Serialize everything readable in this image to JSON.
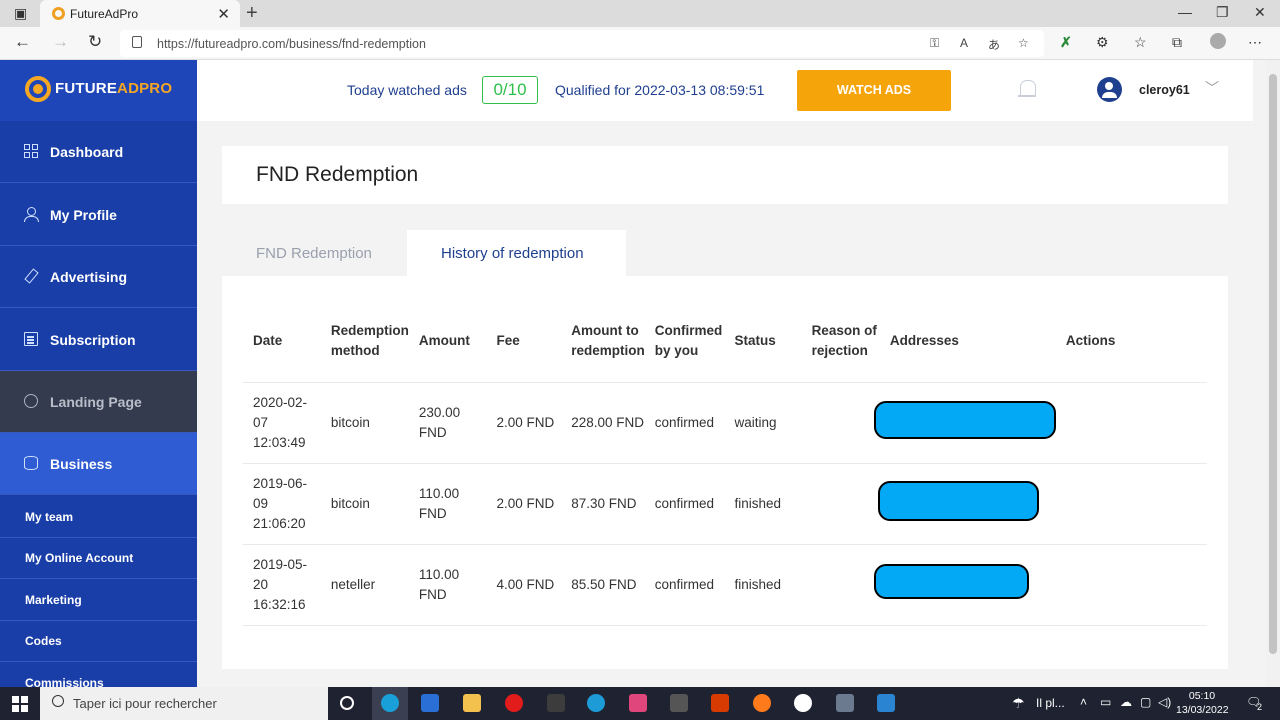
{
  "browser": {
    "tab_title": "FutureAdPro",
    "url": "https://futureadpro.com/business/fnd-redemption"
  },
  "logo": {
    "brand_main": "FUTURE",
    "brand_accent": "ADPRO"
  },
  "sidebar": {
    "items": [
      {
        "label": "Dashboard",
        "icon": "grid-icon"
      },
      {
        "label": "My Profile",
        "icon": "user-icon"
      },
      {
        "label": "Advertising",
        "icon": "megaphone-icon"
      },
      {
        "label": "Subscription",
        "icon": "document-icon"
      },
      {
        "label": "Landing Page",
        "icon": "globe-icon"
      },
      {
        "label": "Business",
        "icon": "database-icon"
      }
    ],
    "subitems": [
      "My team",
      "My Online Account",
      "Marketing",
      "Codes",
      "Commissions"
    ]
  },
  "header": {
    "watched_label": "Today watched ads",
    "watched_count": "0/10",
    "qualified_text": "Qualified for 2022-03-13 08:59:51",
    "watch_button": "WATCH ADS",
    "username": "cleroy61"
  },
  "page": {
    "title": "FND Redemption",
    "tabs": [
      "FND Redemption",
      "History of redemption"
    ],
    "active_tab": "History of redemption"
  },
  "table": {
    "headers": [
      "Date",
      "Redemption method",
      "Amount",
      "Fee",
      "Amount to redemption",
      "Confirmed by you",
      "Status",
      "Reason of rejection",
      "Addresses",
      "Actions"
    ],
    "rows": [
      {
        "date": "2020-02-07 12:03:49",
        "method": "bitcoin",
        "amount": "230.00 FND",
        "fee": "2.00 FND",
        "amount_to": "228.00 FND",
        "confirmed": "confirmed",
        "status": "waiting",
        "reason": ""
      },
      {
        "date": "2019-06-09 21:06:20",
        "method": "bitcoin",
        "amount": "110.00 FND",
        "fee": "2.00 FND",
        "amount_to": "87.30 FND",
        "confirmed": "confirmed",
        "status": "finished",
        "reason": ""
      },
      {
        "date": "2019-05-20 16:32:16",
        "method": "neteller",
        "amount": "110.00 FND",
        "fee": "4.00 FND",
        "amount_to": "85.50 FND",
        "confirmed": "confirmed",
        "status": "finished",
        "reason": ""
      }
    ]
  },
  "taskbar": {
    "search_placeholder": "Taper ici pour rechercher",
    "weather": "Il pl...",
    "time": "05:10",
    "date": "13/03/2022",
    "notifications": "2"
  },
  "colors": {
    "sidebar": "#1a3ea8",
    "accent_orange": "#f5a40a",
    "counter_green": "#2fbf4a",
    "redacted_blue": "#03a9f4"
  }
}
